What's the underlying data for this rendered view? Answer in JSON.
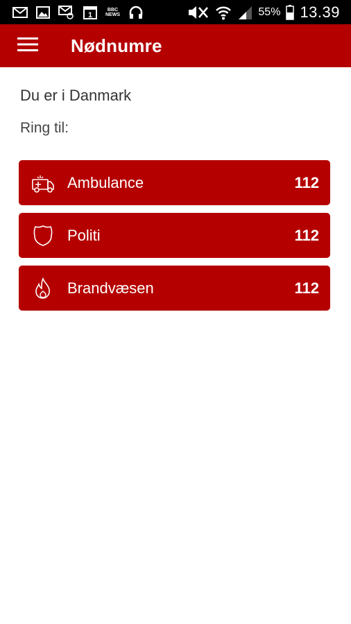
{
  "status_bar": {
    "icons": [
      "gmail-icon",
      "gallery-icon",
      "voicemail-icon",
      "calendar-icon",
      "bbc-news-icon",
      "headphones-icon",
      "mute-icon",
      "wifi-icon",
      "signal-icon",
      "battery-icon"
    ],
    "calendar_day": "1",
    "bbc_top": "BBC",
    "bbc_bottom": "NEWS",
    "battery": "55%",
    "time": "13.39"
  },
  "app_bar": {
    "title": "Nødnumre",
    "menu_icon": "hamburger-menu-icon"
  },
  "main": {
    "location_text": "Du er i Danmark",
    "call_prompt": "Ring til:",
    "services": [
      {
        "label": "Ambulance",
        "number": "112",
        "icon": "ambulance-icon"
      },
      {
        "label": "Politi",
        "number": "112",
        "icon": "police-badge-icon"
      },
      {
        "label": "Brandvæsen",
        "number": "112",
        "icon": "fire-icon"
      }
    ]
  },
  "colors": {
    "accent": "#b50000",
    "status_bar": "#000000",
    "background": "#ffffff",
    "text_dark": "#333333"
  }
}
